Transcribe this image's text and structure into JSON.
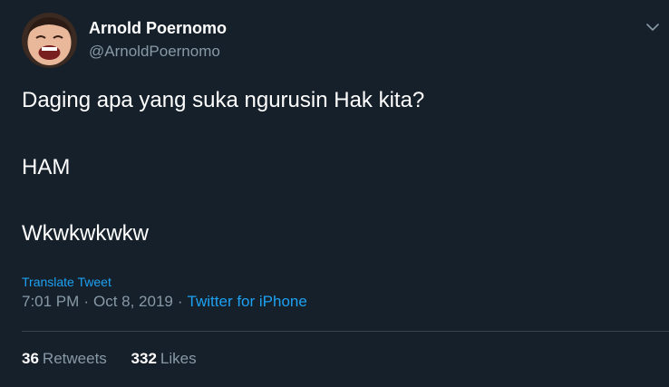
{
  "user": {
    "name": "Arnold Poernomo",
    "handle": "@ArnoldPoernomo"
  },
  "tweet": {
    "lines": [
      "Daging apa yang suka ngurusin Hak kita?",
      "HAM",
      "Wkwkwkwkw"
    ],
    "translate_label": "Translate Tweet",
    "time": "7:01 PM",
    "separator": "·",
    "date": "Oct 8, 2019",
    "source": "Twitter for iPhone"
  },
  "stats": {
    "retweets_count": "36",
    "retweets_label": "Retweets",
    "likes_count": "332",
    "likes_label": "Likes"
  },
  "icons": {
    "more": "chevron-down-icon"
  },
  "colors": {
    "background": "#15202b",
    "text_primary": "#ffffff",
    "text_secondary": "#8899a6",
    "link": "#1da1f2",
    "divider": "#38444d"
  }
}
